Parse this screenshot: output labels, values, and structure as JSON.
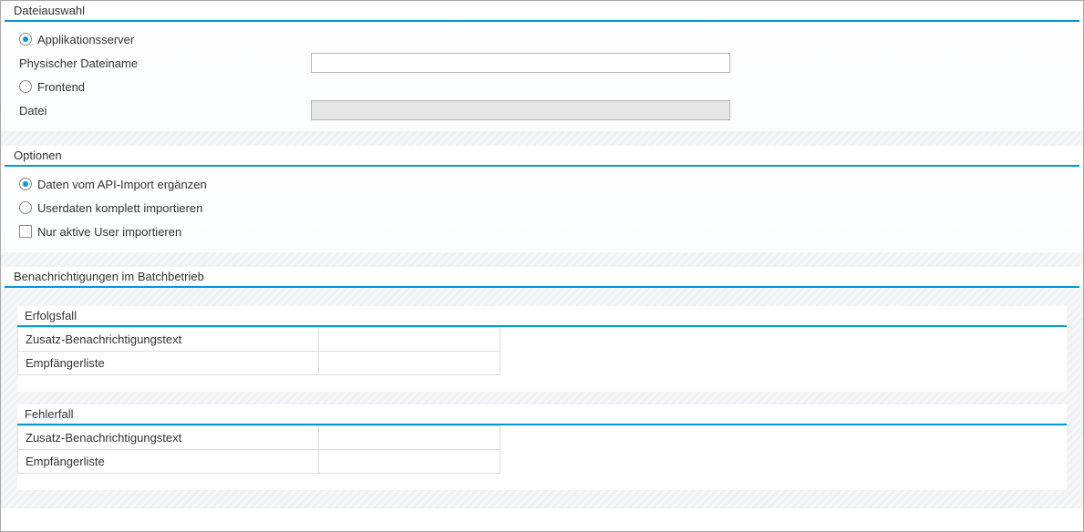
{
  "file_selection": {
    "title": "Dateiauswahl",
    "application_server_label": "Applikationsserver",
    "application_server_selected": true,
    "physical_filename_label": "Physischer Dateiname",
    "physical_filename_value": "",
    "frontend_label": "Frontend",
    "frontend_selected": false,
    "file_label": "Datei",
    "file_value": ""
  },
  "options": {
    "title": "Optionen",
    "api_supplement_label": "Daten vom API-Import ergänzen",
    "api_supplement_selected": true,
    "full_import_label": "Userdaten komplett importieren",
    "full_import_selected": false,
    "only_active_label": "Nur aktive User importieren",
    "only_active_checked": false
  },
  "notifications": {
    "title": "Benachrichtigungen im Batchbetrieb",
    "success": {
      "title": "Erfolgsfall",
      "additional_text_label": "Zusatz-Benachrichtigungstext",
      "additional_text_value": "",
      "recipients_label": "Empfängerliste",
      "recipients_value": ""
    },
    "error": {
      "title": "Fehlerfall",
      "additional_text_label": "Zusatz-Benachrichtigungstext",
      "additional_text_value": "",
      "recipients_label": "Empfängerliste",
      "recipients_value": ""
    }
  }
}
